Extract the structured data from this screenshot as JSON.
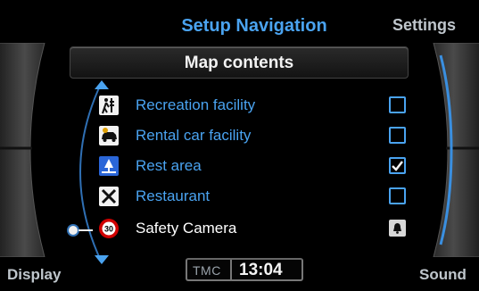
{
  "top_bar": {
    "title": "Setup Navigation",
    "right_label": "Settings"
  },
  "header": {
    "title": "Map contents"
  },
  "items": [
    {
      "label": "Recreation facility",
      "icon": "recreation-facility-icon",
      "checked": false,
      "selected": false
    },
    {
      "label": "Rental car facility",
      "icon": "rental-car-icon",
      "checked": false,
      "selected": false
    },
    {
      "label": "Rest area",
      "icon": "rest-area-icon",
      "checked": true,
      "selected": false
    },
    {
      "label": "Restaurant",
      "icon": "restaurant-icon",
      "checked": false,
      "selected": false
    },
    {
      "label": "Safety Camera",
      "icon": "safety-camera-icon",
      "checked": false,
      "selected": true,
      "badge_text": "30"
    }
  ],
  "bottom_bar": {
    "left_label": "Display",
    "right_label": "Sound",
    "tmc": "TMC",
    "time": "13:04"
  },
  "colors": {
    "accent": "#4aa3f0",
    "text_selected": "#ffffff",
    "background": "#000000"
  }
}
